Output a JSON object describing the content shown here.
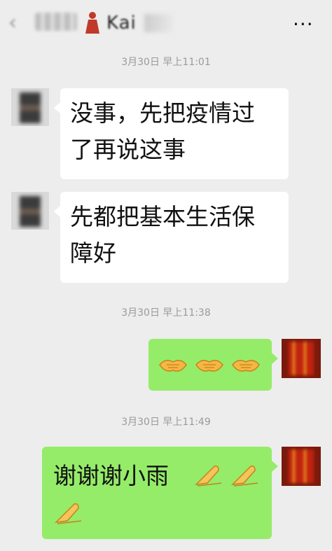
{
  "header": {
    "title": "Kai",
    "back_icon": "chevron-left-icon",
    "more_icon": "more-icon"
  },
  "messages": [
    {
      "timestamp": "3月30日 早上11:01"
    },
    {
      "side": "left",
      "text_line1": "没事，先把疫情过",
      "text_line2": "了再说这事"
    },
    {
      "side": "left",
      "text_line1": "先都把基本生活保",
      "text_line2": "障好"
    },
    {
      "timestamp": "3月30日 早上11:38"
    },
    {
      "side": "right",
      "emoji": [
        "handshake-icon",
        "handshake-icon",
        "handshake-icon"
      ]
    },
    {
      "timestamp": "3月30日 早上11:49"
    },
    {
      "side": "right",
      "text": "谢谢谢小雨",
      "emoji_after": [
        "pray-hands-icon",
        "pray-hands-icon"
      ],
      "emoji_line2": [
        "pray-hands-icon"
      ]
    }
  ],
  "colors": {
    "background": "#ededed",
    "bubble_left": "#ffffff",
    "bubble_right": "#95ec69",
    "timestamp_text": "#9a9a9a"
  }
}
